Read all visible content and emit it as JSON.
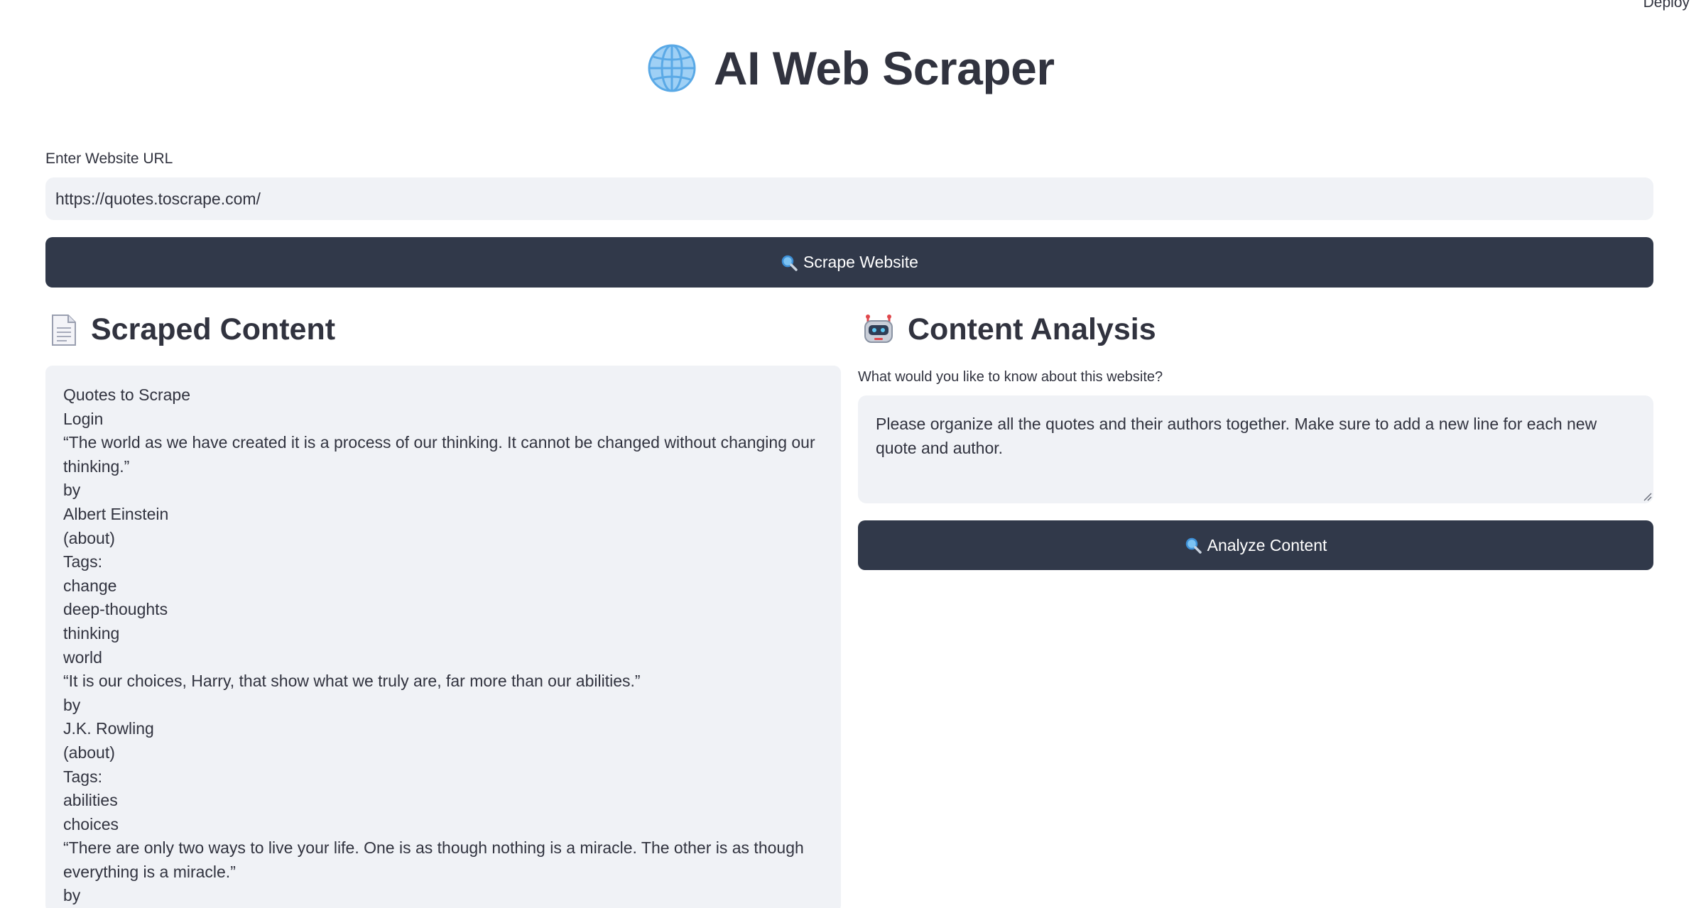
{
  "header": {
    "deploy_label": "Deploy"
  },
  "title": {
    "icon": "globe-icon",
    "text": "AI Web Scraper"
  },
  "url_input": {
    "label": "Enter Website URL",
    "value": "https://quotes.toscrape.com/"
  },
  "scrape_button": {
    "icon": "magnifier-icon",
    "label": "Scrape Website"
  },
  "scraped_section": {
    "icon": "document-icon",
    "heading": "Scraped Content",
    "lines": [
      "Quotes to Scrape",
      "Login",
      "“The world as we have created it is a process of our thinking. It cannot be changed without changing our thinking.”",
      "by",
      "Albert Einstein",
      "(about)",
      "Tags:",
      "change",
      "deep-thoughts",
      "thinking",
      "world",
      "“It is our choices, Harry, that show what we truly are, far more than our abilities.”",
      "by",
      "J.K. Rowling",
      "(about)",
      "Tags:",
      "abilities",
      "choices",
      "“There are only two ways to live your life. One is as though nothing is a miracle. The other is as though everything is a miracle.”",
      "by"
    ]
  },
  "analysis_section": {
    "icon": "robot-icon",
    "heading": "Content Analysis",
    "question_label": "What would you like to know about this website?",
    "question_value": "Please organize all the quotes and their authors together. Make sure to add a new line for each new quote and author.",
    "analyze_button_label": "Analyze Content"
  },
  "colors": {
    "button_bg": "#31394a",
    "input_bg": "#f0f2f6",
    "text": "#31333f"
  }
}
